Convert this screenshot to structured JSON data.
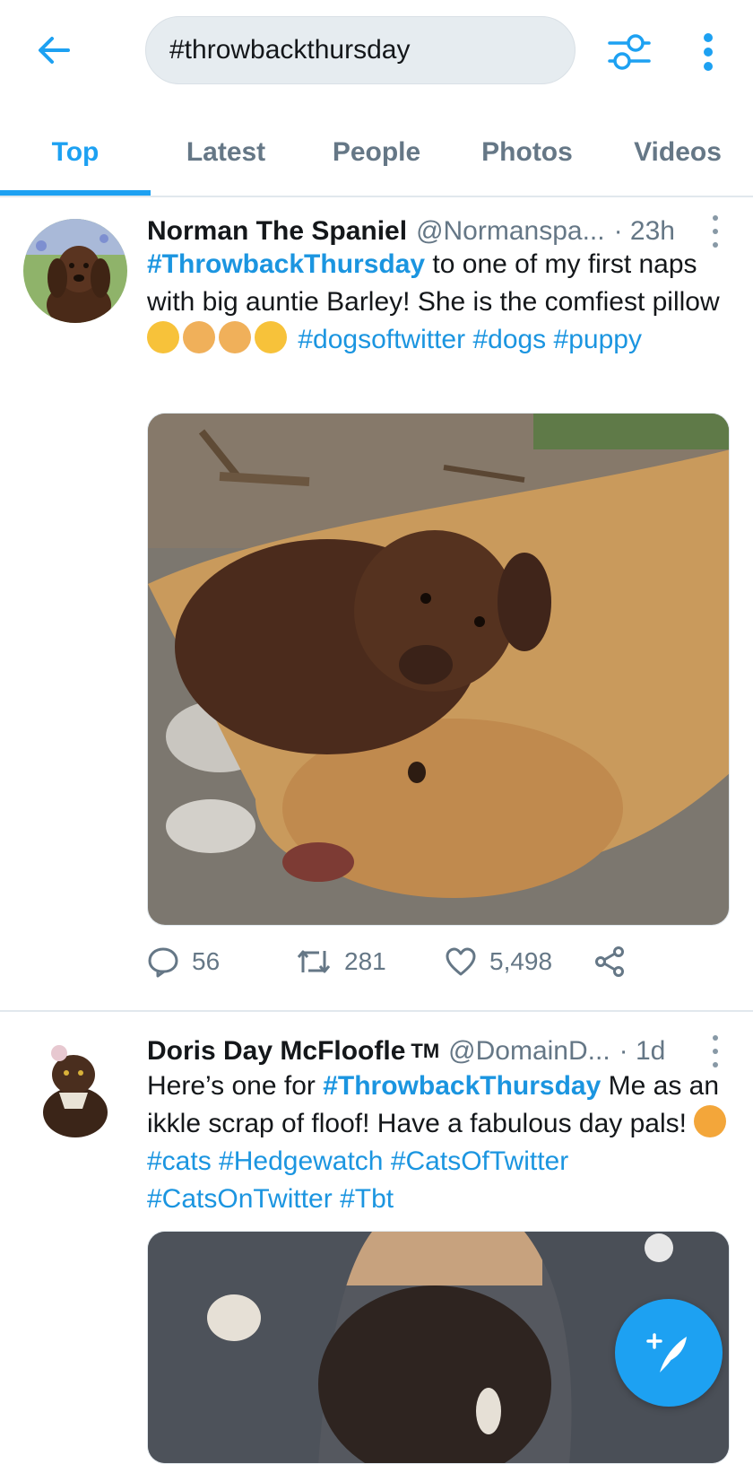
{
  "header": {
    "search_value": "#throwbackthursday",
    "back_icon": "arrow-left-icon",
    "filter_icon": "sliders-icon",
    "more_icon": "vertical-dots-icon"
  },
  "tabs": [
    {
      "label": "Top",
      "active": true
    },
    {
      "label": "Latest",
      "active": false
    },
    {
      "label": "People",
      "active": false
    },
    {
      "label": "Photos",
      "active": false
    },
    {
      "label": "Videos",
      "active": false
    }
  ],
  "tweets": [
    {
      "name": "Norman The Spaniel",
      "handle": "@Normanspa...",
      "time": "· 23h",
      "text": {
        "hashtag_lead": "#ThrowbackThursday",
        "line_rest": " to one of my first naps with big auntie Barley! She is the comfiest pillow",
        "tags": "#dogsoftwitter #dogs #puppy"
      },
      "emojis": [
        "smiling-face-with-hearts",
        "dog-face",
        "dog-face",
        "smiling-face-with-hearts"
      ],
      "media_description": "photo: brown spaniel puppy sleeping on a golden labrador",
      "stats": {
        "replies": "56",
        "retweets": "281",
        "likes": "5,498"
      }
    },
    {
      "name": "Doris Day McFloofle",
      "badge": "TM",
      "handle": "@DomainD...",
      "time": "· 1d",
      "text": {
        "lead": "Here’s one for ",
        "hashtag": "#ThrowbackThursday",
        "rest": " Me as an ikkle scrap of floof! Have a fabulous day pals!",
        "tags": "#cats #Hedgewatch #CatsOfTwitter #CatsOnTwitter #Tbt"
      },
      "emojis": [
        "heart-eyes-cat"
      ],
      "media_description": "photo: dark kitten on a lap"
    }
  ],
  "fab": {
    "icon": "compose-feather-icon"
  },
  "colors": {
    "accent": "#1da1f2",
    "hashtag": "#1b95e0",
    "secondary_text": "#657786",
    "divider": "#e1e8ed"
  }
}
